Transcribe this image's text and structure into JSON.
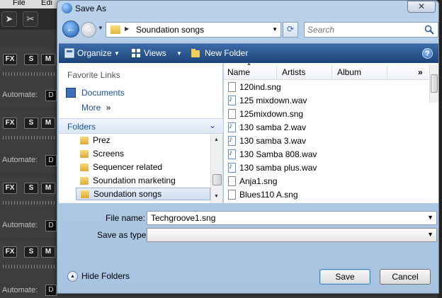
{
  "background_app": {
    "menu": [
      "File",
      "Edi"
    ],
    "tracks": [
      {
        "buttons": [
          "FX",
          "S",
          "M"
        ],
        "automate_label": "Automate:",
        "automate_btn": "D"
      },
      {
        "buttons": [
          "FX",
          "S",
          "M"
        ],
        "automate_label": "Automate:",
        "automate_btn": "D"
      },
      {
        "buttons": [
          "FX",
          "S",
          "M"
        ],
        "automate_label": "Automate:",
        "automate_btn": "D"
      },
      {
        "buttons": [
          "FX",
          "S",
          "M"
        ],
        "automate_label": "Automate:",
        "automate_btn": "D"
      }
    ]
  },
  "dialog": {
    "title": "Save As",
    "close_glyph": "✕",
    "address": {
      "path": "Soundation songs"
    },
    "search": {
      "placeholder": "Search"
    },
    "commandbar": {
      "organize": "Organize",
      "views": "Views",
      "new_folder": "New Folder",
      "help": "?"
    },
    "nav": {
      "favorite_links_title": "Favorite Links",
      "links": [
        "Documents",
        "More"
      ],
      "more_glyph": "»",
      "folders_title": "Folders",
      "folders": [
        "Prez",
        "Screens",
        "Sequencer related",
        "Soundation marketing",
        "Soundation songs"
      ],
      "selected_folder": "Soundation songs"
    },
    "filelist": {
      "columns": [
        "Name",
        "Artists",
        "Album"
      ],
      "more_cols_glyph": "»",
      "files": [
        {
          "name": "120ind.sng",
          "type": "sng"
        },
        {
          "name": "125 mixdown.wav",
          "type": "wav"
        },
        {
          "name": "125mixdown.sng",
          "type": "sng"
        },
        {
          "name": "130 samba 2.wav",
          "type": "wav"
        },
        {
          "name": "130 samba 3.wav",
          "type": "wav"
        },
        {
          "name": "130 Samba 808.wav",
          "type": "wav"
        },
        {
          "name": "130 samba plus.wav",
          "type": "wav"
        },
        {
          "name": "Anja1.sng",
          "type": "sng"
        },
        {
          "name": "Blues110 A.sng",
          "type": "sng"
        }
      ]
    },
    "form": {
      "file_name_label": "File name:",
      "file_name_value": "Techgroove1.sng",
      "save_as_type_label": "Save as type:",
      "save_as_type_value": ""
    },
    "hide_folders": "Hide Folders",
    "save_button": "Save",
    "cancel_button": "Cancel"
  },
  "colors": {
    "accent": "#1a4fa0",
    "command_bar": "#1c4377"
  }
}
